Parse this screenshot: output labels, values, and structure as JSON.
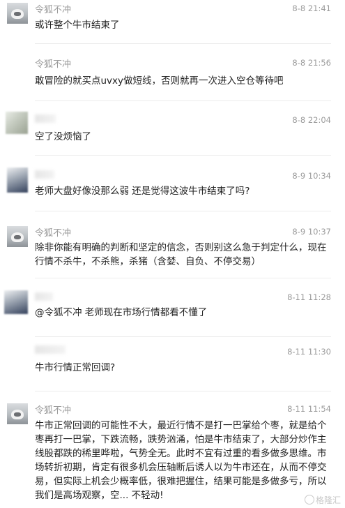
{
  "comments": [
    {
      "author": "令狐不冲",
      "time": "8-8 21:41",
      "text": "或许整个牛市结束了"
    },
    {
      "author": "令狐不冲",
      "time": "8-8 21:56",
      "text": "敢冒险的就买点uvxy做短线，否则就再一次进入空仓等待吧"
    },
    {
      "author": "",
      "time": "8-8 22:04",
      "text": "空了没烦恼了"
    },
    {
      "author": "",
      "time": "8-9 10:34",
      "text": "老师大盘好像没那么弱 还是觉得这波牛市结束了吗?"
    },
    {
      "author": "令狐不冲",
      "time": "8-9 10:37",
      "text": "除非你能有明确的判断和坚定的信念，否则别这么急于判定什么，现在行情不杀牛，不杀熊，杀猪（含婪、自负、不停交易）"
    },
    {
      "author": "",
      "time": "8-11 11:28",
      "text": "@令狐不冲 老师现在市场行情都看不懂了"
    },
    {
      "author": "",
      "time": "8-11 11:30",
      "text": "牛市行情正常回调?"
    },
    {
      "author": "令狐不冲",
      "time": "8-11 11:54",
      "text": "牛市正常回调的可能性不大，最近行情不是打一巴掌给个枣，就是给个枣再打一巴掌，下跌流畅，跌势汹涌，怕是牛市结束了，大部分炒作主线股都跌的稀里哗啦，气势全无。此时不宜有过重的看多做多思维。市场转折初期，肯定有很多机会压轴断后诱人以为牛市还在，从而不停交易，但实际上机会少概率低，很难把握住，结果可能是多做多亏，所以我们是高场观察，空... 不轻动!"
    }
  ],
  "watermark": "格隆汇"
}
